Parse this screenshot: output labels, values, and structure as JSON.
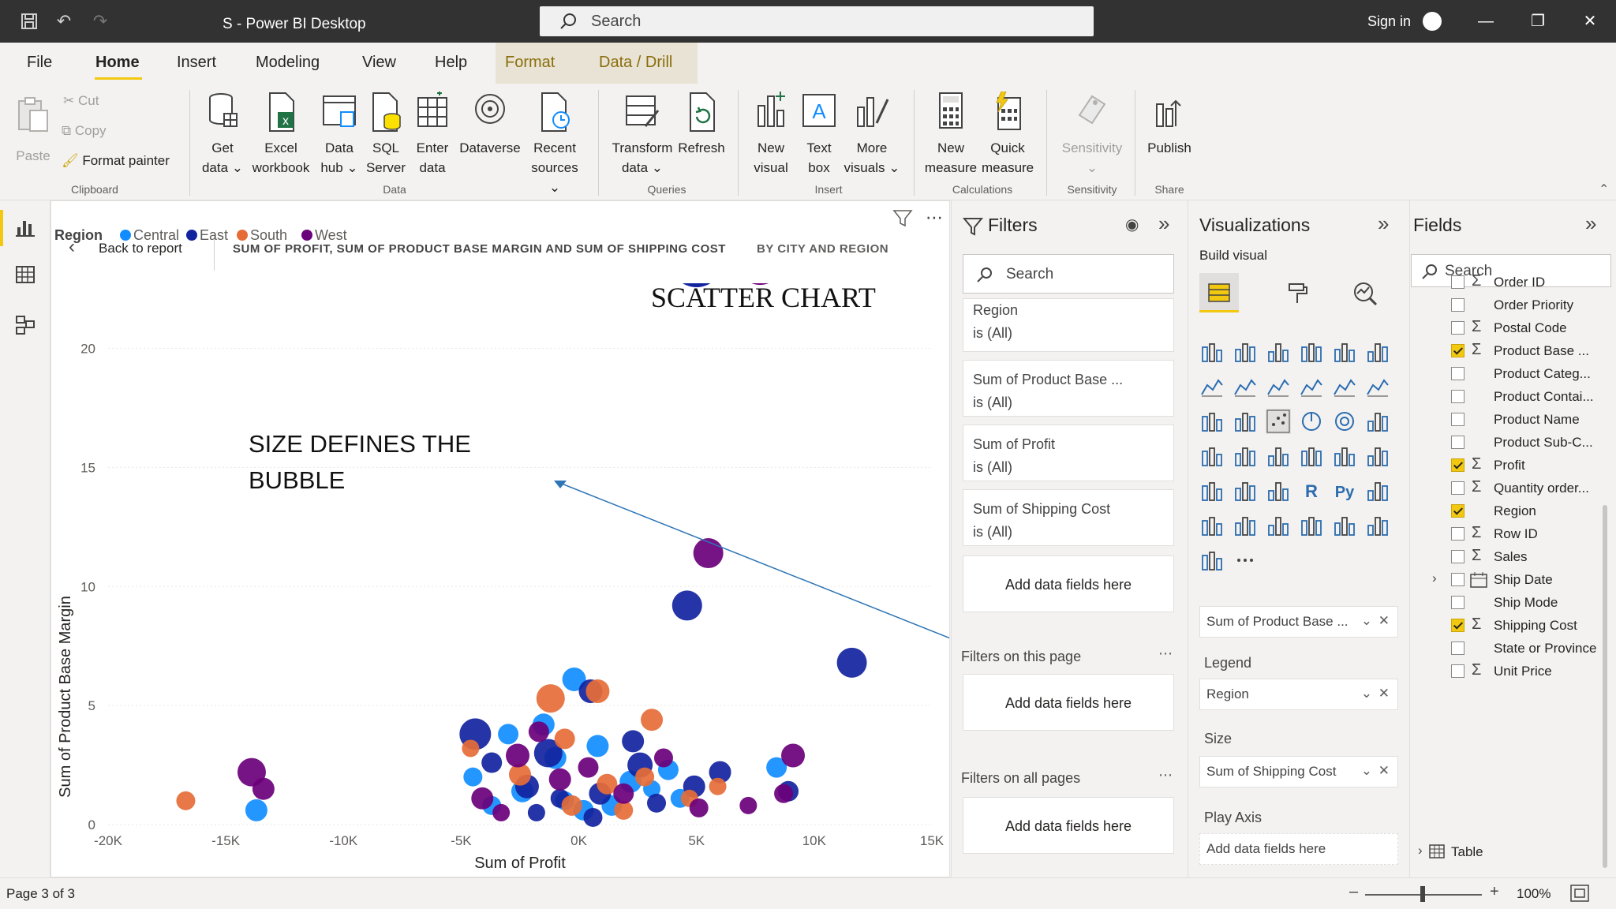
{
  "titlebar": {
    "title": "S - Power BI Desktop",
    "search_placeholder": "Search",
    "signin": "Sign in"
  },
  "menu": {
    "items": [
      "File",
      "Home",
      "Insert",
      "Modeling",
      "View",
      "Help",
      "Format",
      "Data / Drill"
    ],
    "active": "Home"
  },
  "ribbon": {
    "clipboard": {
      "paste": "Paste",
      "cut": "Cut",
      "copy": "Copy",
      "format_painter": "Format painter",
      "group": "Clipboard"
    },
    "data": {
      "get_data": [
        "Get",
        "data"
      ],
      "excel": [
        "Excel",
        "workbook"
      ],
      "data_hub": [
        "Data",
        "hub"
      ],
      "sql": [
        "SQL",
        "Server"
      ],
      "enter": [
        "Enter",
        "data"
      ],
      "dataverse": "Dataverse",
      "recent": [
        "Recent",
        "sources"
      ],
      "group": "Data"
    },
    "queries": {
      "transform": [
        "Transform",
        "data"
      ],
      "refresh": "Refresh",
      "group": "Queries"
    },
    "insert": {
      "new_visual": [
        "New",
        "visual"
      ],
      "text_box": [
        "Text",
        "box"
      ],
      "more_visuals": [
        "More",
        "visuals"
      ],
      "group": "Insert"
    },
    "calculations": {
      "new_measure": [
        "New",
        "measure"
      ],
      "quick_measure": [
        "Quick",
        "measure"
      ],
      "group": "Calculations"
    },
    "sensitivity": {
      "label": "Sensitivity",
      "group": "Sensitivity"
    },
    "share": {
      "publish": "Publish",
      "group": "Share"
    }
  },
  "canvas": {
    "back": "Back to report",
    "visual_title": "SUM OF PROFIT, SUM OF PRODUCT BASE MARGIN AND SUM OF SHIPPING COST",
    "visual_by": "BY CITY AND REGION",
    "annotation_title": "SCATTER CHART",
    "annotation_size": [
      "SIZE DEFINES THE",
      "BUBBLE"
    ]
  },
  "chart_data": {
    "type": "scatter",
    "xlabel": "Sum of Profit",
    "ylabel": "Sum of Product Base Margin",
    "legend_title": "Region",
    "legend_position": "top-left",
    "xlim": [
      -20000,
      15000
    ],
    "ylim": [
      0,
      23
    ],
    "x_ticks": [
      "-20K",
      "-15K",
      "-10K",
      "-5K",
      "0K",
      "5K",
      "10K",
      "15K"
    ],
    "y_ticks": [
      "0",
      "5",
      "10",
      "15",
      "20"
    ],
    "grid": true,
    "colors": {
      "Central": "#118dff",
      "East": "#12239e",
      "South": "#e66c37",
      "West": "#6b007b"
    },
    "series": [
      {
        "name": "Central",
        "points": [
          [
            -13700,
            0.6,
            14
          ],
          [
            -200,
            6.1,
            15
          ],
          [
            -3000,
            3.8,
            13
          ],
          [
            -1500,
            4.2,
            14
          ],
          [
            800,
            3.3,
            14
          ],
          [
            2200,
            1.8,
            14
          ],
          [
            3800,
            2.3,
            13
          ],
          [
            -4500,
            2.0,
            12
          ],
          [
            -2400,
            1.4,
            14
          ],
          [
            -600,
            1.0,
            12
          ],
          [
            1400,
            0.8,
            13
          ],
          [
            4300,
            1.1,
            12
          ],
          [
            8400,
            2.4,
            13
          ],
          [
            -1000,
            2.8,
            14
          ],
          [
            3100,
            1.5,
            11
          ],
          [
            -3700,
            0.8,
            12
          ],
          [
            200,
            0.6,
            13
          ]
        ]
      },
      {
        "name": "East",
        "points": [
          [
            4600,
            9.2,
            19
          ],
          [
            11600,
            6.8,
            19
          ],
          [
            -4400,
            3.8,
            20
          ],
          [
            500,
            5.6,
            15
          ],
          [
            -1300,
            3.0,
            18
          ],
          [
            2600,
            2.5,
            16
          ],
          [
            -2200,
            1.6,
            15
          ],
          [
            900,
            1.3,
            14
          ],
          [
            6000,
            2.2,
            14
          ],
          [
            8900,
            1.4,
            13
          ],
          [
            -3700,
            2.6,
            13
          ],
          [
            -800,
            1.1,
            12
          ],
          [
            3300,
            0.9,
            12
          ],
          [
            4900,
            1.6,
            14
          ],
          [
            -1800,
            0.5,
            11
          ],
          [
            600,
            0.3,
            12
          ],
          [
            2300,
            3.5,
            14
          ]
        ]
      },
      {
        "name": "South",
        "points": [
          [
            -16700,
            1.0,
            12
          ],
          [
            -1200,
            5.3,
            18
          ],
          [
            800,
            5.6,
            15
          ],
          [
            3100,
            4.4,
            14
          ],
          [
            -2500,
            2.1,
            14
          ],
          [
            1200,
            1.7,
            13
          ],
          [
            -300,
            0.8,
            13
          ],
          [
            1900,
            0.6,
            12
          ],
          [
            5900,
            1.6,
            11
          ],
          [
            -4600,
            3.2,
            11
          ],
          [
            -600,
            3.6,
            13
          ],
          [
            2800,
            2.0,
            12
          ],
          [
            4700,
            1.1,
            11
          ]
        ]
      },
      {
        "name": "West",
        "points": [
          [
            -13900,
            2.2,
            18
          ],
          [
            -13400,
            1.5,
            14
          ],
          [
            5500,
            11.4,
            19
          ],
          [
            8700,
            1.3,
            12
          ],
          [
            9100,
            2.9,
            15
          ],
          [
            -4100,
            1.1,
            14
          ],
          [
            -2600,
            2.9,
            15
          ],
          [
            -800,
            1.9,
            14
          ],
          [
            1900,
            1.3,
            13
          ],
          [
            5100,
            0.7,
            12
          ],
          [
            -1700,
            3.9,
            13
          ],
          [
            400,
            2.4,
            13
          ],
          [
            3600,
            2.8,
            12
          ],
          [
            7200,
            0.8,
            11
          ],
          [
            -3300,
            0.5,
            11
          ]
        ]
      }
    ],
    "offscale_bubbles": [
      {
        "name": "East",
        "x": 5000,
        "y": 23,
        "size": 34
      },
      {
        "name": "West",
        "x": 7700,
        "y": 23,
        "size": 31
      }
    ]
  },
  "filters": {
    "title": "Filters",
    "search_placeholder": "Search",
    "cards": [
      {
        "name": "Region",
        "value": "is (All)"
      },
      {
        "name": "Sum of Product Base ...",
        "value": "is (All)"
      },
      {
        "name": "Sum of Profit",
        "value": "is (All)"
      },
      {
        "name": "Sum of Shipping Cost",
        "value": "is (All)"
      }
    ],
    "add_fields": "Add data fields here",
    "on_this_page": "Filters on this page",
    "on_all_pages": "Filters on all pages"
  },
  "visualizations": {
    "title": "Visualizations",
    "build_visual": "Build visual",
    "wells": {
      "y_field": "Sum of Product Base ...",
      "legend_label": "Legend",
      "legend_field": "Region",
      "size_label": "Size",
      "size_field": "Sum of Shipping Cost",
      "play_axis_label": "Play Axis",
      "play_axis_placeholder": "Add data fields here"
    }
  },
  "fields": {
    "title": "Fields",
    "search_placeholder": "Search",
    "items": [
      {
        "name": "Order ID",
        "sigma": true,
        "checked": false
      },
      {
        "name": "Order Priority",
        "sigma": false,
        "checked": false
      },
      {
        "name": "Postal Code",
        "sigma": true,
        "checked": false
      },
      {
        "name": "Product Base ...",
        "sigma": true,
        "checked": true
      },
      {
        "name": "Product Categ...",
        "sigma": false,
        "checked": false
      },
      {
        "name": "Product Contai...",
        "sigma": false,
        "checked": false
      },
      {
        "name": "Product Name",
        "sigma": false,
        "checked": false
      },
      {
        "name": "Product Sub-C...",
        "sigma": false,
        "checked": false
      },
      {
        "name": "Profit",
        "sigma": true,
        "checked": true
      },
      {
        "name": "Quantity order...",
        "sigma": true,
        "checked": false
      },
      {
        "name": "Region",
        "sigma": false,
        "checked": true
      },
      {
        "name": "Row ID",
        "sigma": true,
        "checked": false
      },
      {
        "name": "Sales",
        "sigma": true,
        "checked": false
      },
      {
        "name": "Ship Date",
        "sigma": false,
        "checked": false,
        "calendar": true
      },
      {
        "name": "Ship Mode",
        "sigma": false,
        "checked": false
      },
      {
        "name": "Shipping Cost",
        "sigma": true,
        "checked": true
      },
      {
        "name": "State or Province",
        "sigma": false,
        "checked": false
      },
      {
        "name": "Unit Price",
        "sigma": true,
        "checked": false
      }
    ],
    "table": "Table"
  },
  "status": {
    "page": "Page 3 of 3",
    "zoom": "100%"
  }
}
